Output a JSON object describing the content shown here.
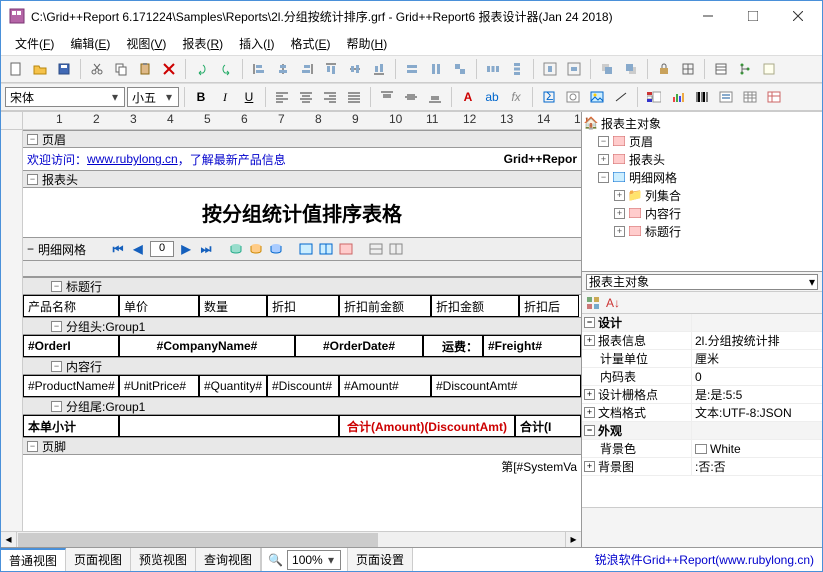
{
  "window": {
    "title": "C:\\Grid++Report 6.171224\\Samples\\Reports\\2l.分组按统计排序.grf - Grid++Report6 报表设计器(Jan 24 2018)"
  },
  "menu": {
    "file": "文件",
    "file_k": "F",
    "edit": "编辑",
    "edit_k": "E",
    "view": "视图",
    "view_k": "V",
    "report": "报表",
    "report_k": "R",
    "insert": "插入",
    "insert_k": "I",
    "format": "格式",
    "format_k": "E",
    "help": "帮助",
    "help_k": "H"
  },
  "fontbar": {
    "font": "宋体",
    "size": "小五"
  },
  "bands": {
    "pageheader": "页眉",
    "welcome_pre": "欢迎访问：",
    "welcome_link": "www.rubylong.cn",
    "welcome_post": "，了解最新产品信息",
    "gridreport": "Grid++Repor",
    "reportheader": "报表头",
    "bigtitle": "按分组统计值排序表格",
    "detailgrid": "明细网格",
    "navvalue": "0",
    "titlerow": "标题行",
    "cols": [
      "产品名称",
      "单价",
      "数量",
      "折扣",
      "折扣前金额",
      "折扣金额",
      "折扣后"
    ],
    "grouphead": "分组头:Group1",
    "gh_cells": [
      "#OrderI",
      "#CompanyName#",
      "#OrderDate#",
      "运费：",
      "#Freight#"
    ],
    "contentrow": "内容行",
    "cr_cells": [
      "#ProductName#",
      "#UnitPrice#",
      "#Quantity#",
      "#Discount#",
      "#Amount#",
      "#DiscountAmt#"
    ],
    "groupfoot": "分组尾:Group1",
    "gf_label": "本单小计",
    "gf_red": "合计(Amount)(DiscountAmt)",
    "gf_tail": "合计(I",
    "pagefooter": "页脚",
    "pf_right": "第[#SystemVa"
  },
  "tree": {
    "root": "报表主对象",
    "items": [
      "页眉",
      "报表头",
      "明细网格",
      "列集合",
      "内容行",
      "标题行"
    ]
  },
  "props": {
    "selector": "报表主对象",
    "cat_design": "设计",
    "rows": [
      {
        "k": "报表信息",
        "v": "2l.分组按统计排"
      },
      {
        "k": "计量单位",
        "v": "厘米"
      },
      {
        "k": "内码表",
        "v": "0"
      },
      {
        "k": "设计栅格点",
        "v": "是:是:5:5"
      },
      {
        "k": "文档格式",
        "v": "文本:UTF-8:JSON"
      }
    ],
    "cat_appear": "外观",
    "rows2": [
      {
        "k": "背景色",
        "v": "White"
      },
      {
        "k": "背景图",
        "v": ":否:否"
      }
    ]
  },
  "tabs": {
    "t1": "普通视图",
    "t2": "页面视图",
    "t3": "预览视图",
    "t4": "查询视图",
    "zoom": "100%",
    "pageset": "页面设置"
  },
  "status": {
    "link": "锐浪软件Grid++Report(www.rubylong.cn)"
  }
}
